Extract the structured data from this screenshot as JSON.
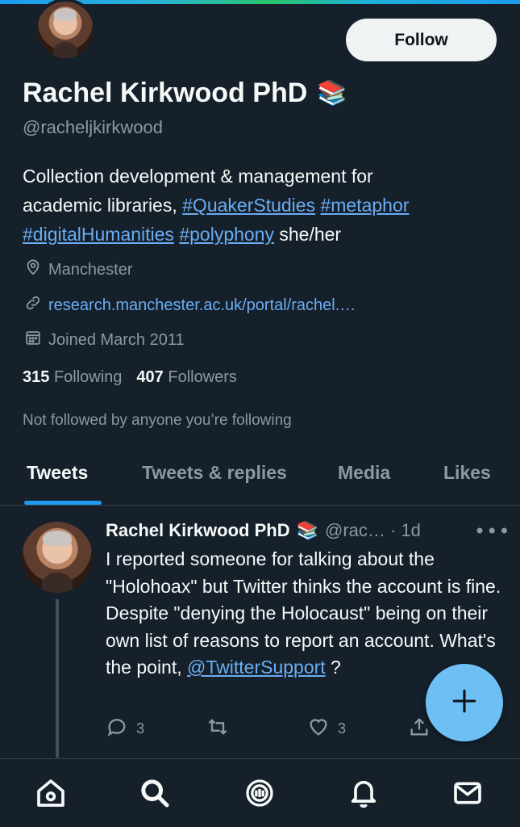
{
  "profile": {
    "name": "Rachel Kirkwood PhD",
    "name_emoji": "📚",
    "handle": "@racheljkirkwood",
    "follow_label": "Follow",
    "bio": {
      "line1": "Collection development & management for",
      "line2_text": "academic libraries, ",
      "tag_quaker": "#QuakerStudies",
      "tag_metaphor": "#metaphor",
      "tag_digital": "#digitalHumanities",
      "tag_polyphony": "#polyphony",
      "pronouns": " she/her"
    },
    "location": "Manchester",
    "website": "research.manchester.ac.uk/portal/rachel.…",
    "joined": "Joined March 2011",
    "following_count": "315",
    "following_label": "Following",
    "followers_count": "407",
    "followers_label": "Followers",
    "not_followed": "Not followed by anyone you’re following"
  },
  "tabs": [
    {
      "label": "Tweets",
      "active": true
    },
    {
      "label": "Tweets & replies",
      "active": false
    },
    {
      "label": "Media",
      "active": false
    },
    {
      "label": "Likes",
      "active": false
    }
  ],
  "tweet": {
    "author": "Rachel Kirkwood PhD",
    "author_emoji": "📚",
    "meta": "@rac… · 1d",
    "more": "•••",
    "body": "I reported someone for talking about the \"Holohoax\" but Twitter thinks the account is fine. Despite \"denying the Holocaust\" being on their own list of reasons to report an account. What's the point, ",
    "mention": "@TwitterSupport",
    "end": " ?",
    "reply_count": "3",
    "retweet_count": "",
    "like_count": "3"
  },
  "icons": {
    "location": "map-pin-icon",
    "website": "link-icon",
    "joined": "calendar-icon",
    "reply": "reply-icon",
    "retweet": "retweet-icon",
    "like": "heart-icon",
    "share": "share-icon",
    "compose": "plus-icon",
    "nav": [
      "home-icon",
      "search-icon",
      "spaces-icon",
      "notifications-icon",
      "messages-icon"
    ]
  },
  "colors": {
    "background": "#15202b",
    "accent": "#1d9bf0",
    "link": "#6aadf2",
    "muted": "#8b98a5"
  }
}
